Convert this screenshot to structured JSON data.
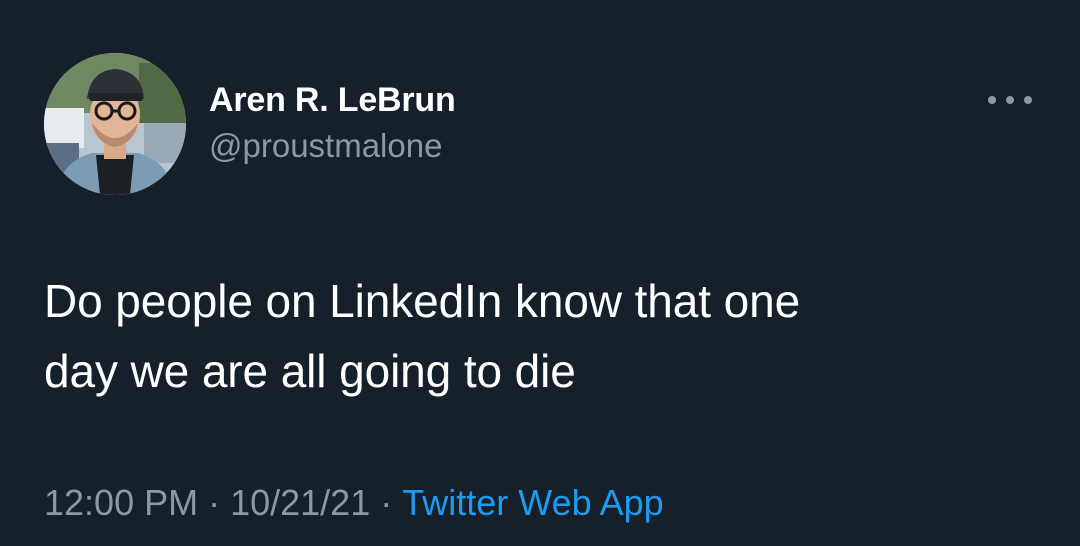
{
  "tweet": {
    "author": {
      "display_name": "Aren R. LeBrun",
      "handle": "@proustmalone"
    },
    "text_line1": "Do people on LinkedIn know that one",
    "text_line2": "day we are all going to die",
    "time": "12:00 PM",
    "separator": "·",
    "date": "10/21/21",
    "source": "Twitter Web App"
  },
  "icons": {
    "more": "more-horizontal-icon"
  },
  "colors": {
    "background": "#15202b",
    "primary_text": "#ffffff",
    "secondary_text": "#8b98a5",
    "link": "#1d9bf0"
  }
}
